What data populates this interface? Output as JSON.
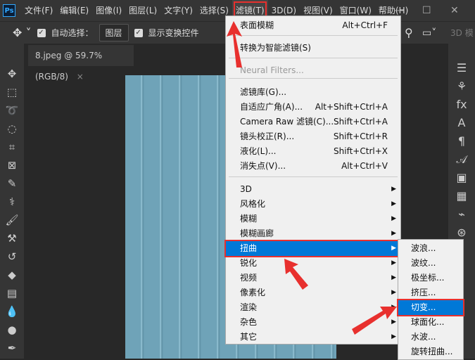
{
  "app": {
    "logo": "Ps"
  },
  "menubar": [
    "文件(F)",
    "编辑(E)",
    "图像(I)",
    "图层(L)",
    "文字(Y)",
    "选择(S)",
    "滤镜(T)",
    "3D(D)",
    "视图(V)",
    "窗口(W)",
    "帮助(H)"
  ],
  "window": {
    "minimize": "—",
    "maximize": "☐",
    "close": "✕"
  },
  "toolbar": {
    "auto_select_label": "自动选择：",
    "layer_dropdown": "图层",
    "show_transform_label": "显示变换控件",
    "mode_3d": "3D 模"
  },
  "document_tab": {
    "title": "8.jpeg @ 59.7%(RGB/8)",
    "close": "×"
  },
  "filter_menu": {
    "items": [
      {
        "label": "表面模糊",
        "shortcut": "Alt+Ctrl+F"
      },
      {
        "label": "转换为智能滤镜(S)"
      },
      {
        "label": "Neural Filters...",
        "disabled": true
      },
      {
        "label": "滤镜库(G)..."
      },
      {
        "label": "自适应广角(A)...",
        "shortcut": "Alt+Shift+Ctrl+A"
      },
      {
        "label": "Camera Raw 滤镜(C)...",
        "shortcut": "Shift+Ctrl+A"
      },
      {
        "label": "镜头校正(R)...",
        "shortcut": "Shift+Ctrl+R"
      },
      {
        "label": "液化(L)...",
        "shortcut": "Shift+Ctrl+X"
      },
      {
        "label": "消失点(V)...",
        "shortcut": "Alt+Ctrl+V"
      },
      {
        "label": "3D",
        "submenu": true
      },
      {
        "label": "风格化",
        "submenu": true
      },
      {
        "label": "模糊",
        "submenu": true
      },
      {
        "label": "模糊画廊",
        "submenu": true
      },
      {
        "label": "扭曲",
        "submenu": true,
        "highlighted": true
      },
      {
        "label": "锐化",
        "submenu": true
      },
      {
        "label": "视频",
        "submenu": true
      },
      {
        "label": "像素化",
        "submenu": true
      },
      {
        "label": "渲染",
        "submenu": true
      },
      {
        "label": "杂色",
        "submenu": true
      },
      {
        "label": "其它",
        "submenu": true
      }
    ]
  },
  "distort_submenu": {
    "items": [
      {
        "label": "波浪..."
      },
      {
        "label": "波纹..."
      },
      {
        "label": "极坐标..."
      },
      {
        "label": "挤压..."
      },
      {
        "label": "切变...",
        "highlighted": true
      },
      {
        "label": "球面化..."
      },
      {
        "label": "水波..."
      },
      {
        "label": "旋转扭曲..."
      }
    ]
  },
  "colors": {
    "highlight": "#0078d7",
    "annotation": "#e8302e"
  }
}
